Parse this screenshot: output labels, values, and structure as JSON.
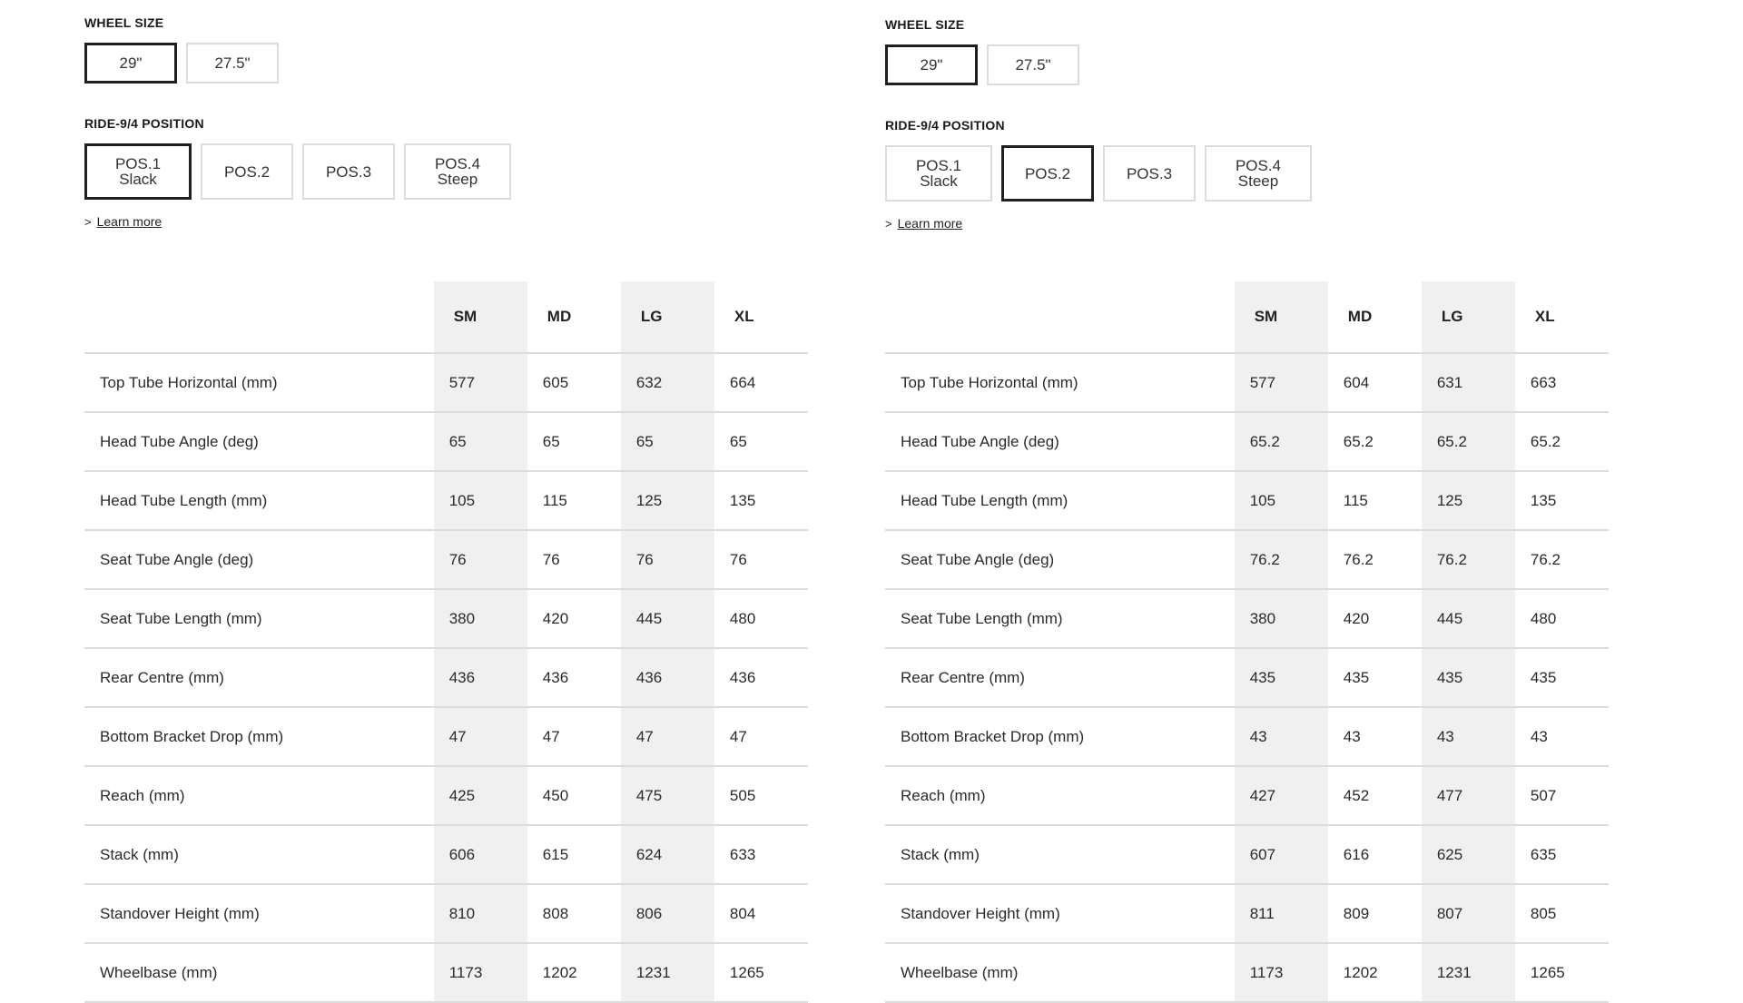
{
  "panels": [
    {
      "wheel_size": {
        "label": "WHEEL SIZE",
        "options": [
          {
            "label": "29\"",
            "selected": true
          },
          {
            "label": "27.5\"",
            "selected": false
          }
        ]
      },
      "position": {
        "label": "RIDE-9/4 POSITION",
        "options": [
          {
            "line1": "POS.1",
            "line2": "Slack",
            "selected": true
          },
          {
            "line1": "POS.2",
            "line2": "",
            "selected": false
          },
          {
            "line1": "POS.3",
            "line2": "",
            "selected": false
          },
          {
            "line1": "POS.4",
            "line2": "Steep",
            "selected": false
          }
        ]
      },
      "learn_more": {
        "chevron": ">",
        "label": "Learn more"
      },
      "table": {
        "columns": [
          "SM",
          "MD",
          "LG",
          "XL"
        ],
        "rows": [
          {
            "label": "Top Tube Horizontal (mm)",
            "values": [
              "577",
              "605",
              "632",
              "664"
            ]
          },
          {
            "label": "Head Tube Angle (deg)",
            "values": [
              "65",
              "65",
              "65",
              "65"
            ]
          },
          {
            "label": "Head Tube Length (mm)",
            "values": [
              "105",
              "115",
              "125",
              "135"
            ]
          },
          {
            "label": "Seat Tube Angle (deg)",
            "values": [
              "76",
              "76",
              "76",
              "76"
            ]
          },
          {
            "label": "Seat Tube Length (mm)",
            "values": [
              "380",
              "420",
              "445",
              "480"
            ]
          },
          {
            "label": "Rear Centre (mm)",
            "values": [
              "436",
              "436",
              "436",
              "436"
            ]
          },
          {
            "label": "Bottom Bracket Drop (mm)",
            "values": [
              "47",
              "47",
              "47",
              "47"
            ]
          },
          {
            "label": "Reach (mm)",
            "values": [
              "425",
              "450",
              "475",
              "505"
            ]
          },
          {
            "label": "Stack (mm)",
            "values": [
              "606",
              "615",
              "624",
              "633"
            ]
          },
          {
            "label": "Standover Height (mm)",
            "values": [
              "810",
              "808",
              "806",
              "804"
            ]
          },
          {
            "label": "Wheelbase (mm)",
            "values": [
              "1173",
              "1202",
              "1231",
              "1265"
            ]
          }
        ]
      }
    },
    {
      "wheel_size": {
        "label": "WHEEL SIZE",
        "options": [
          {
            "label": "29\"",
            "selected": true
          },
          {
            "label": "27.5\"",
            "selected": false
          }
        ]
      },
      "position": {
        "label": "RIDE-9/4 POSITION",
        "options": [
          {
            "line1": "POS.1",
            "line2": "Slack",
            "selected": false
          },
          {
            "line1": "POS.2",
            "line2": "",
            "selected": true
          },
          {
            "line1": "POS.3",
            "line2": "",
            "selected": false
          },
          {
            "line1": "POS.4",
            "line2": "Steep",
            "selected": false
          }
        ]
      },
      "learn_more": {
        "chevron": ">",
        "label": "Learn more"
      },
      "table": {
        "columns": [
          "SM",
          "MD",
          "LG",
          "XL"
        ],
        "rows": [
          {
            "label": "Top Tube Horizontal (mm)",
            "values": [
              "577",
              "604",
              "631",
              "663"
            ]
          },
          {
            "label": "Head Tube Angle (deg)",
            "values": [
              "65.2",
              "65.2",
              "65.2",
              "65.2"
            ]
          },
          {
            "label": "Head Tube Length (mm)",
            "values": [
              "105",
              "115",
              "125",
              "135"
            ]
          },
          {
            "label": "Seat Tube Angle (deg)",
            "values": [
              "76.2",
              "76.2",
              "76.2",
              "76.2"
            ]
          },
          {
            "label": "Seat Tube Length (mm)",
            "values": [
              "380",
              "420",
              "445",
              "480"
            ]
          },
          {
            "label": "Rear Centre (mm)",
            "values": [
              "435",
              "435",
              "435",
              "435"
            ]
          },
          {
            "label": "Bottom Bracket Drop (mm)",
            "values": [
              "43",
              "43",
              "43",
              "43"
            ]
          },
          {
            "label": "Reach (mm)",
            "values": [
              "427",
              "452",
              "477",
              "507"
            ]
          },
          {
            "label": "Stack (mm)",
            "values": [
              "607",
              "616",
              "625",
              "635"
            ]
          },
          {
            "label": "Standover Height (mm)",
            "values": [
              "811",
              "809",
              "807",
              "805"
            ]
          },
          {
            "label": "Wheelbase (mm)",
            "values": [
              "1173",
              "1202",
              "1231",
              "1265"
            ]
          }
        ]
      }
    }
  ]
}
